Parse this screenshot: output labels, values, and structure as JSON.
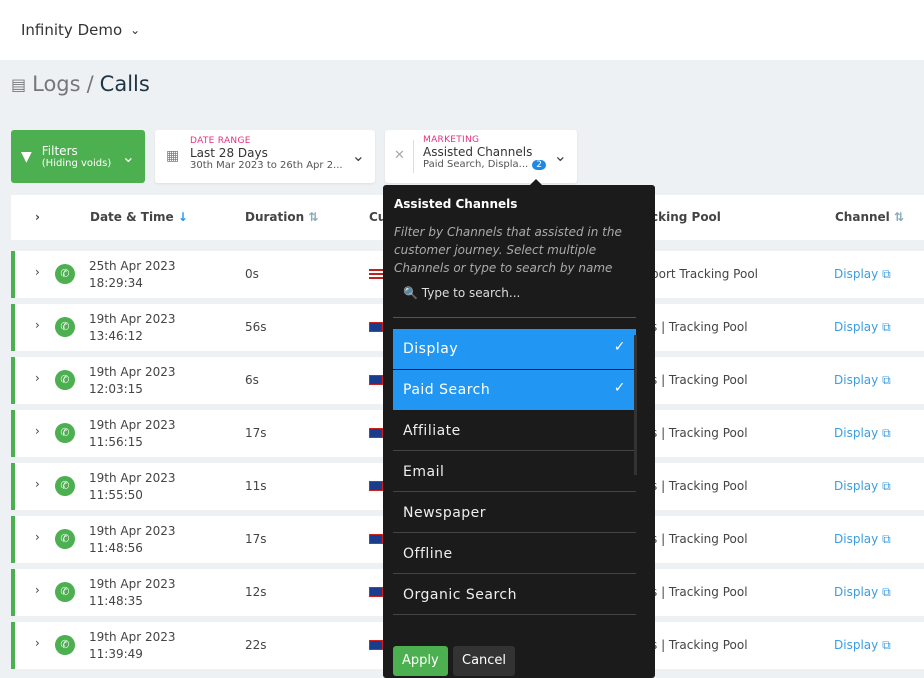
{
  "app": {
    "name": "Infinity Demo"
  },
  "breadcrumb": {
    "parent": "Logs",
    "separator": "/",
    "current": "Calls"
  },
  "filters": {
    "label": "Filters",
    "sub": "(Hiding voids)"
  },
  "date_range": {
    "label": "DATE RANGE",
    "value": "Last 28 Days",
    "sub": "30th Mar 2023 to 26th Apr 2..."
  },
  "marketing": {
    "label": "MARKETING",
    "value": "Assisted Channels",
    "sub": "Paid Search, Displa...",
    "count": "2"
  },
  "columns": {
    "datetime": "Date & Time",
    "duration": "Duration",
    "customer": "Cu",
    "pool": "cking Pool",
    "channel": "Channel"
  },
  "rows": [
    {
      "date": "25th Apr 2023",
      "time": "18:29:34",
      "duration": "0s",
      "flag": "us",
      "pool": "port Tracking Pool",
      "channel": "Display"
    },
    {
      "date": "19th Apr 2023",
      "time": "13:46:12",
      "duration": "56s",
      "flag": "gb",
      "pool": "s | Tracking Pool",
      "channel": "Display"
    },
    {
      "date": "19th Apr 2023",
      "time": "12:03:15",
      "duration": "6s",
      "flag": "gb",
      "pool": "s | Tracking Pool",
      "channel": "Display"
    },
    {
      "date": "19th Apr 2023",
      "time": "11:56:15",
      "duration": "17s",
      "flag": "gb",
      "pool": "s | Tracking Pool",
      "channel": "Display"
    },
    {
      "date": "19th Apr 2023",
      "time": "11:55:50",
      "duration": "11s",
      "flag": "gb",
      "pool": "s | Tracking Pool",
      "channel": "Display"
    },
    {
      "date": "19th Apr 2023",
      "time": "11:48:56",
      "duration": "17s",
      "flag": "gb",
      "pool": "s | Tracking Pool",
      "channel": "Display"
    },
    {
      "date": "19th Apr 2023",
      "time": "11:48:35",
      "duration": "12s",
      "flag": "gb",
      "pool": "s | Tracking Pool",
      "channel": "Display"
    },
    {
      "date": "19th Apr 2023",
      "time": "11:39:49",
      "duration": "22s",
      "flag": "gb",
      "pool": "s | Tracking Pool",
      "channel": "Display"
    }
  ],
  "popup": {
    "title": "Assisted Channels",
    "description": "Filter by Channels that assisted in the customer journey. Select multiple Channels or type to search by name",
    "search_placeholder": "Type to search...",
    "options": [
      {
        "label": "Display",
        "selected": true
      },
      {
        "label": "Paid Search",
        "selected": true
      },
      {
        "label": "Affiliate",
        "selected": false
      },
      {
        "label": "Email",
        "selected": false
      },
      {
        "label": "Newspaper",
        "selected": false
      },
      {
        "label": "Offline",
        "selected": false
      },
      {
        "label": "Organic Search",
        "selected": false
      }
    ],
    "apply": "Apply",
    "cancel": "Cancel"
  },
  "colors": {
    "green": "#4caf50",
    "accent_blue": "#2196f3",
    "pink": "#e6317f"
  }
}
